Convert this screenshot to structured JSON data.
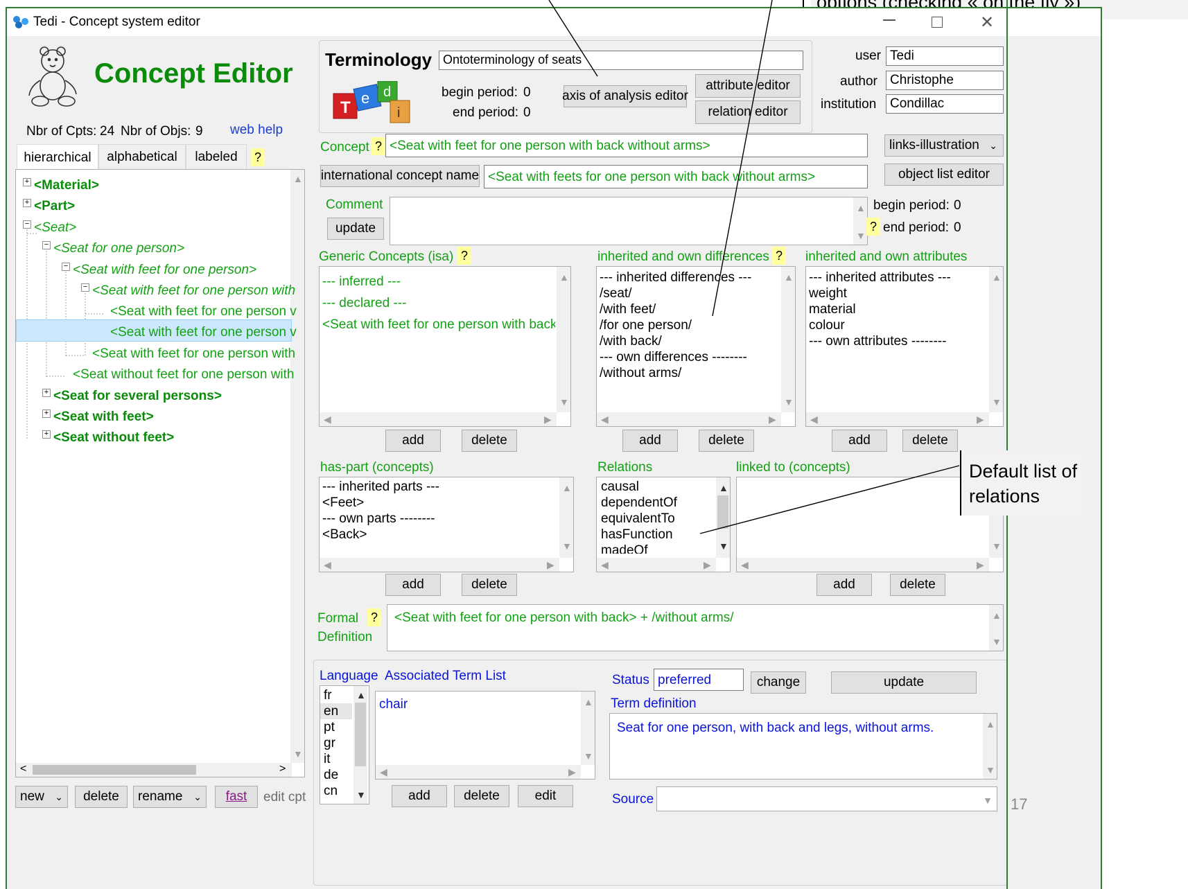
{
  "window": {
    "title": "Tedi - Concept system editor"
  },
  "header": {
    "app_name": "Concept Editor",
    "nbr_cpts_label": "Nbr of Cpts:",
    "nbr_cpts": "24",
    "nbr_objs_label": "Nbr of Objs:",
    "nbr_objs": "9",
    "web_help": "web help"
  },
  "left_tabs": [
    "hierarchical",
    "alphabetical",
    "labeled",
    "?"
  ],
  "tree": [
    {
      "label": "<Material>"
    },
    {
      "label": "<Part>"
    },
    {
      "label": "<Seat>"
    },
    {
      "label": "<Seat for one person>"
    },
    {
      "label": "<Seat with feet for one person>"
    },
    {
      "label": "<Seat with feet for one person with"
    },
    {
      "label": "<Seat with feet for one person v"
    },
    {
      "label": "<Seat with feet for one person v"
    },
    {
      "label": "<Seat with feet for one person with"
    },
    {
      "label": "<Seat without feet for one person with"
    },
    {
      "label": "<Seat for several persons>"
    },
    {
      "label": "<Seat with feet>"
    },
    {
      "label": "<Seat without feet>"
    }
  ],
  "left_bottom": {
    "new": "new",
    "delete": "delete",
    "rename": "rename",
    "fast": "fast",
    "edit_cpt": "edit cpt"
  },
  "terminology": {
    "label": "Terminology",
    "name": "Ontoterminology of seats",
    "begin_label": "begin period:",
    "begin_value": "0",
    "end_label": "end period:",
    "end_value": "0",
    "axis_button": "axis of analysis editor",
    "attribute_button": "attribute editor",
    "relation_button": "relation editor"
  },
  "user_info": {
    "user_label": "user",
    "user": "Tedi",
    "author_label": "author",
    "author": "Christophe",
    "institution_label": "institution",
    "institution": "Condillac"
  },
  "concept": {
    "label": "Concept",
    "q": "?",
    "value": "<Seat with feet for one person with back without arms>",
    "links_select": "links-illustration",
    "intl_button": "international concept name",
    "intl_value": "<Seat with feets for one person with back without arms>",
    "object_list_button": "object list editor",
    "comment_label": "Comment",
    "update_button": "update",
    "begin_label": "begin period:",
    "begin_value": "0",
    "end_label": "end period:",
    "end_value": "0"
  },
  "generic": {
    "label": "Generic Concepts (isa)",
    "items": [
      "--- inferred ---",
      "--- declared ---",
      "<Seat with feet for one person with back>"
    ],
    "add": "add",
    "delete": "delete"
  },
  "differences": {
    "label": "inherited and own differences",
    "items": [
      "--- inherited differences ---",
      "/seat/",
      "/with feet/",
      "/for one person/",
      "/with back/",
      "--- own differences --------",
      "/without arms/"
    ],
    "add": "add",
    "delete": "delete"
  },
  "attributes": {
    "label": "inherited and own attributes",
    "items": [
      "--- inherited attributes ---",
      "weight",
      "material",
      "colour",
      "--- own attributes --------"
    ],
    "add": "add",
    "delete": "delete"
  },
  "has_part": {
    "label": "has-part (concepts)",
    "items": [
      "--- inherited parts ---",
      "<Feet>",
      "--- own parts --------",
      "<Back>"
    ],
    "add": "add",
    "delete": "delete"
  },
  "relations": {
    "label": "Relations",
    "items": [
      "causal",
      "dependentOf",
      "equivalentTo",
      "hasFunction",
      "madeOf"
    ]
  },
  "linked": {
    "label": "linked to (concepts)",
    "add": "add",
    "delete": "delete"
  },
  "formal": {
    "label1": "Formal",
    "label2": "Definition",
    "q": "?",
    "value": "<Seat with feet for one person with back> + /without arms/"
  },
  "term_section": {
    "language_label": "Language",
    "assoc_label": "Associated Term List",
    "languages": [
      "fr",
      "en",
      "pt",
      "gr",
      "it",
      "de",
      "cn"
    ],
    "terms": [
      "chair"
    ],
    "add": "add",
    "delete": "delete",
    "edit": "edit",
    "status_label": "Status",
    "status_value": "preferred",
    "change": "change",
    "update": "update",
    "term_def_label": "Term definition",
    "term_def": "Seat for one person, with back and legs, without arms.",
    "source_label": "Source"
  },
  "callouts": {
    "top": "options (checking « on the fly »)",
    "relations": "Default list of relations"
  },
  "slide_number": "17",
  "colors": {
    "green_text": "#14a014",
    "blue_text": "#0a14d8",
    "selection": "#cce8ff",
    "window_border": "#2f7d2f"
  }
}
